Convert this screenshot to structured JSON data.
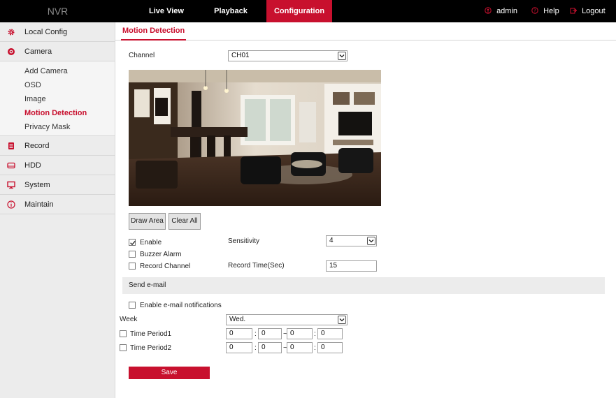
{
  "topbar": {
    "brand": "NVR",
    "tabs": [
      "Live View",
      "Playback",
      "Configuration"
    ],
    "active_tab": "Configuration",
    "user": "admin",
    "help": "Help",
    "logout": "Logout",
    "accent_color": "#c8102e"
  },
  "sidebar": {
    "items": [
      {
        "label": "Local Config",
        "icon": "gear-icon"
      },
      {
        "label": "Camera",
        "icon": "camera-icon"
      },
      {
        "label": "Record",
        "icon": "record-icon"
      },
      {
        "label": "HDD",
        "icon": "hdd-icon"
      },
      {
        "label": "System",
        "icon": "monitor-icon"
      },
      {
        "label": "Maintain",
        "icon": "info-icon"
      }
    ],
    "camera_sub": [
      "Add Camera",
      "OSD",
      "Image",
      "Motion Detection",
      "Privacy Mask"
    ],
    "active_sub": "Motion Detection"
  },
  "main": {
    "tab": "Motion Detection",
    "channel_label": "Channel",
    "channel_value": "CH01",
    "draw_area": "Draw Area",
    "clear_all": "Clear All",
    "enable_label": "Enable",
    "enable_checked": true,
    "buzzer_label": "Buzzer Alarm",
    "buzzer_checked": false,
    "record_channel_label": "Record Channel",
    "record_channel_checked": false,
    "sensitivity_label": "Sensitivity",
    "sensitivity_value": "4",
    "record_time_label": "Record Time(Sec)",
    "record_time_value": "15",
    "send_email_header": "Send e-mail",
    "email_notify_label": "Enable e-mail notifications",
    "email_notify_checked": false,
    "week_label": "Week",
    "week_value": "Wed.",
    "periods": [
      {
        "label": "Time Period1",
        "checked": false,
        "start_h": "0",
        "start_m": "0",
        "end_h": "0",
        "end_m": "0"
      },
      {
        "label": "Time Period2",
        "checked": false,
        "start_h": "0",
        "start_m": "0",
        "end_h": "0",
        "end_m": "0"
      }
    ],
    "save": "Save"
  }
}
